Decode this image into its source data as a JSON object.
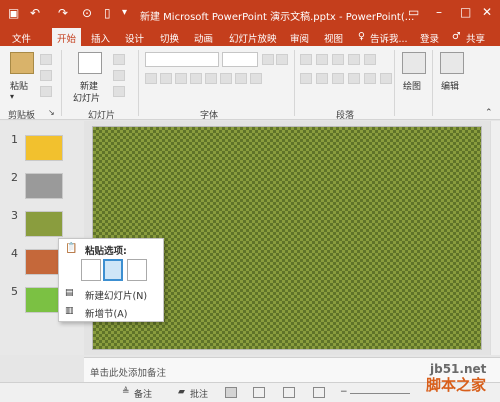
{
  "titlebar": {
    "title": "新建 Microsoft PowerPoint 演示文稿.pptx - PowerPoint(...",
    "qa_icons": [
      "save-icon",
      "undo-icon",
      "redo-icon",
      "presenter-icon",
      "new-file-icon",
      "customize-icon"
    ],
    "window_controls": [
      "ribbon-options-icon",
      "minimize-icon",
      "maximize-icon",
      "close-icon"
    ]
  },
  "tabs": {
    "items": [
      "文件",
      "开始",
      "插入",
      "设计",
      "切换",
      "动画",
      "幻灯片放映",
      "审阅",
      "视图"
    ],
    "tell_me": "告诉我...",
    "login": "登录",
    "share": "共享",
    "active": "开始"
  },
  "ribbon": {
    "paste_label": "粘贴",
    "new_slide_label_1": "新建",
    "new_slide_label_2": "幻灯片",
    "draw_label": "绘图",
    "edit_label": "编辑",
    "groups": {
      "clipboard": "剪贴板",
      "slides": "幻灯片",
      "font": "字体",
      "paragraph": "段落"
    }
  },
  "slides": [
    {
      "number": "1",
      "color": "#f2c12e"
    },
    {
      "number": "2",
      "color": "#9a9a9a"
    },
    {
      "number": "3",
      "color": "#8a9d3e"
    },
    {
      "number": "4",
      "color": "#c5683a"
    },
    {
      "number": "5",
      "color": "#7bc143"
    }
  ],
  "context_menu": {
    "header": "粘贴选项:",
    "item1": "新建幻灯片(N)",
    "item2": "新增节(A)"
  },
  "notes": {
    "placeholder": "单击此处添加备注"
  },
  "statusbar": {
    "notes_label": "备注",
    "comments_label": "批注"
  },
  "watermark": {
    "site": "jb51.net",
    "brand": "脚本之家"
  },
  "colors": {
    "accent": "#c43e1c",
    "slide_bg": "#8a9d3e"
  }
}
